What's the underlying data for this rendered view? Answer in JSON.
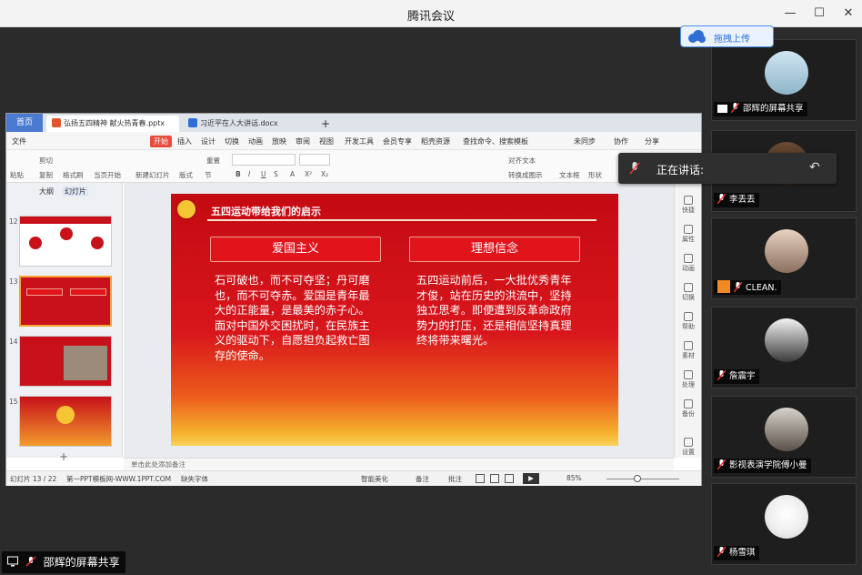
{
  "window": {
    "title": "腾讯会议"
  },
  "share": {
    "label": "邵辉的屏幕共享"
  },
  "upload": {
    "label": "拖拽上传"
  },
  "speaking": {
    "label": "正在讲话:"
  },
  "participants": [
    {
      "name": "邵辉的屏幕共享"
    },
    {
      "name": "李丢丢"
    },
    {
      "name": "CLEAN."
    },
    {
      "name": "詹震宇"
    },
    {
      "name": "影视表演学院傅小曼"
    },
    {
      "name": "杨雪琪"
    }
  ],
  "wps": {
    "home_tab": "首页",
    "tabs": [
      "弘扬五四精神 献火热青春.pptx",
      "习近平在人大讲话.docx"
    ],
    "menu": [
      "文件",
      "开始",
      "插入",
      "设计",
      "切换",
      "动画",
      "放映",
      "审阅",
      "视图",
      "开发工具",
      "会员专享",
      "稻壳资源",
      "查找命令、搜索模板",
      "未同步",
      "协作",
      "分享"
    ],
    "ribbon": [
      "粘贴",
      "剪切",
      "复制",
      "格式刷",
      "当页开始",
      "新建幻灯片",
      "版式",
      "节",
      "重置",
      "B",
      "I",
      "U",
      "S",
      "A",
      "X²",
      "X₂",
      "文本框",
      "形状",
      "对齐文本",
      "转换成图示"
    ],
    "panel_tabs": [
      "大纲",
      "幻灯片"
    ],
    "thumb_numbers": [
      "12",
      "13",
      "14",
      "15"
    ],
    "right_tools": [
      "快捷",
      "属性",
      "动画",
      "切换",
      "帮助",
      "素材",
      "处理",
      "备份",
      "设置"
    ],
    "notes": "单击此处添加备注",
    "status": {
      "slide": "幻灯片 13 / 22",
      "template": "第一PPT模板网-WWW.1PPT.COM",
      "font": "缺失字体",
      "smart": "智能美化",
      "notes_btn": "备注",
      "comment": "批注",
      "zoom": "85%"
    }
  },
  "slide": {
    "title": "五四运动带给我们的启示",
    "left_heading": "爱国主义",
    "right_heading": "理想信念",
    "left_text": "石可破也，而不可夺坚；丹可磨也，而不可夺赤。爱国是青年最大的正能量，是最美的赤子心。面对中国外交困扰时，在民族主义的驱动下，自愿担负起救亡图存的使命。",
    "right_text": "五四运动前后，一大批优秀青年才俊，站在历史的洪流中，坚持独立思考。即便遭到反革命政府势力的打压，还是相信坚持真理终将带来曙光。"
  }
}
